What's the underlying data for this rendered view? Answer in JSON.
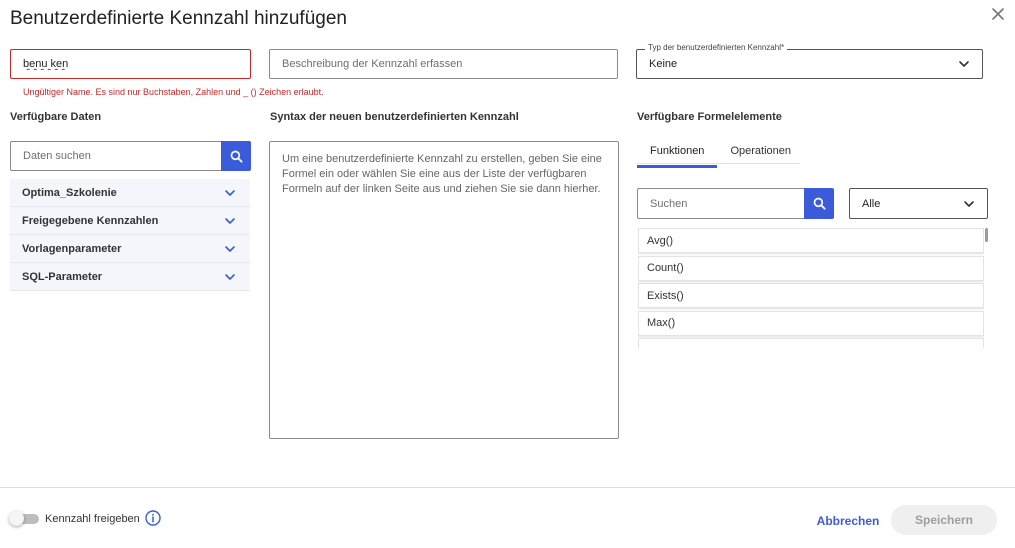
{
  "dialog": {
    "title": "Benutzerdefinierte Kennzahl hinzufügen"
  },
  "name_field": {
    "value": "benu ken",
    "error": "Ungültiger Name. Es sind nur Buchstaben, Zahlen und _ () Zeichen erlaubt."
  },
  "description_field": {
    "placeholder": "Beschreibung der Kennzahl erfassen"
  },
  "type_field": {
    "label": "Typ der benutzerdefinierten Kennzahl*",
    "value": "Keine"
  },
  "available_data": {
    "heading": "Verfügbare Daten",
    "search_placeholder": "Daten suchen",
    "groups": [
      {
        "label": "Optima_Szkolenie"
      },
      {
        "label": "Freigegebene Kennzahlen"
      },
      {
        "label": "Vorlagenparameter"
      },
      {
        "label": "SQL-Parameter"
      }
    ]
  },
  "syntax": {
    "heading": "Syntax der neuen benutzerdefinierten Kennzahl",
    "placeholder": "Um eine benutzerdefinierte Kennzahl zu erstellen, geben Sie eine Formel ein oder wählen Sie eine aus der Liste der verfügbaren Formeln auf der linken Seite aus und ziehen Sie sie dann hierher."
  },
  "formula_elements": {
    "heading": "Verfügbare Formelelemente",
    "tabs": [
      {
        "label": "Funktionen",
        "active": true
      },
      {
        "label": "Operationen",
        "active": false
      }
    ],
    "search_placeholder": "Suchen",
    "filter_value": "Alle",
    "functions": [
      "Avg()",
      "Count()",
      "Exists()",
      "Max()"
    ]
  },
  "footer": {
    "toggle_label": "Kennzahl freigeben",
    "cancel_label": "Abbrechen",
    "save_label": "Speichern"
  },
  "colors": {
    "accent": "#3b5bdb",
    "error": "#c62828"
  }
}
